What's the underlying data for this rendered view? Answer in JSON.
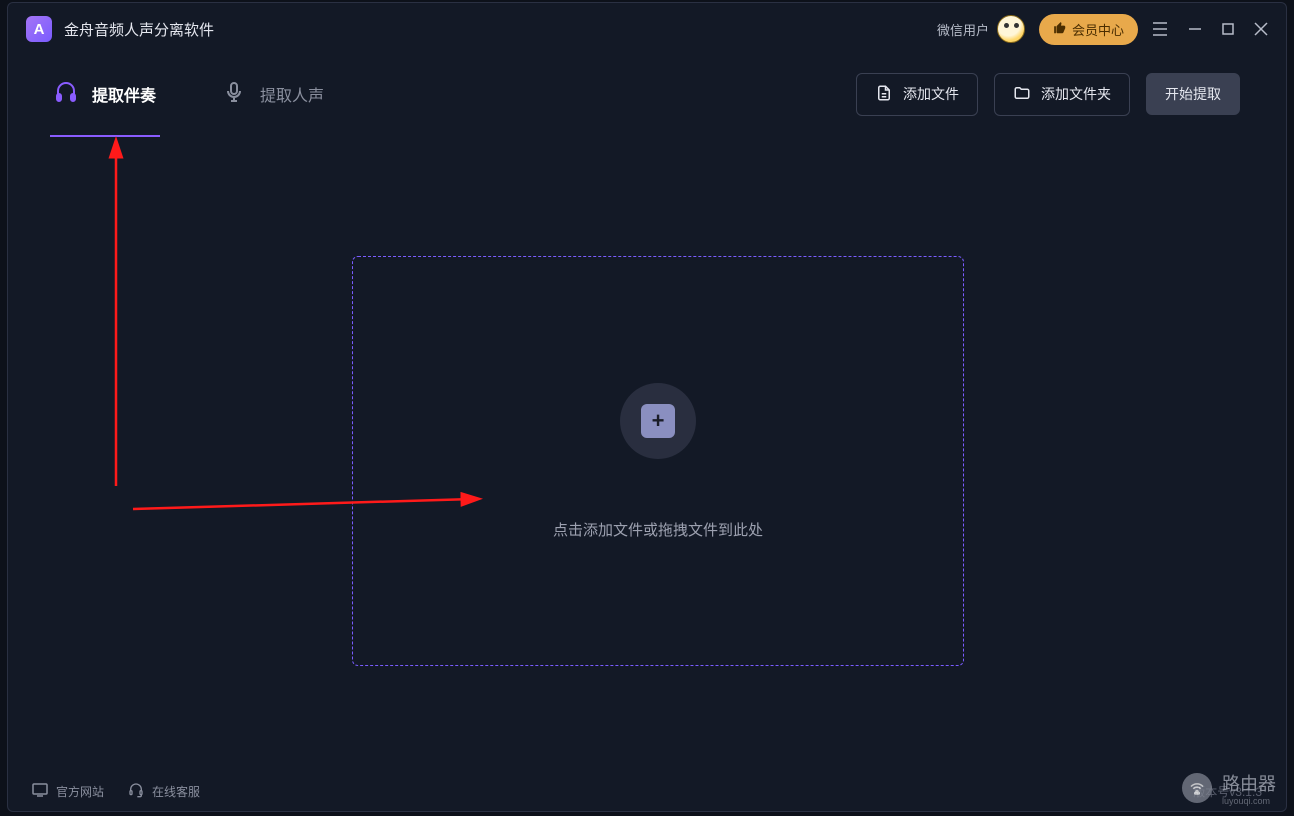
{
  "titlebar": {
    "app_title": "金舟音频人声分离软件",
    "user_label": "微信用户",
    "vip_label": "会员中心"
  },
  "tabs": {
    "accompaniment": "提取伴奏",
    "vocals": "提取人声"
  },
  "toolbar": {
    "add_file": "添加文件",
    "add_folder": "添加文件夹",
    "start_extract": "开始提取"
  },
  "dropzone": {
    "text": "点击添加文件或拖拽文件到此处"
  },
  "footer": {
    "official_site": "官方网站",
    "online_service": "在线客服",
    "version": "版本号v3.1.3"
  },
  "watermark": {
    "text": "路由器",
    "sub": "luyouqi.com"
  }
}
